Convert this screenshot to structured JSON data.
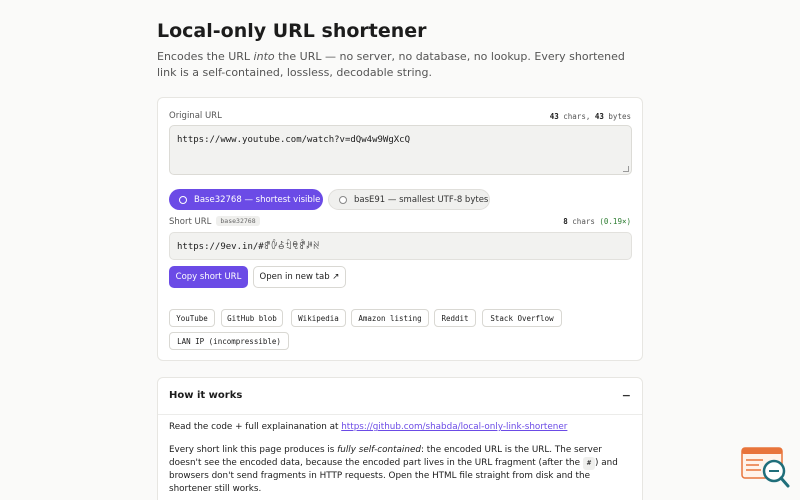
{
  "header": {
    "title": "Local-only URL shortener",
    "lede_pre": "Encodes the URL ",
    "lede_em": "into",
    "lede_post": " the URL — no server, no database, no lookup. Every shortened link is a self-contained, lossless, decodable string."
  },
  "original": {
    "label": "Original URL",
    "chars": "43",
    "chars_unit": " chars, ",
    "bytes": "43",
    "bytes_unit": " bytes",
    "value": "https://www.youtube.com/watch?v=dQw4w9WgXcQ"
  },
  "encodings": [
    {
      "label": "Base32768 — shortest visible",
      "selected": true
    },
    {
      "label": "basE91 — smallest UTF-8 bytes",
      "selected": false
    }
  ],
  "short": {
    "label": "Short URL",
    "tag": "base32768",
    "chars": "8",
    "chars_unit": " chars ",
    "ratio": "(0.19×)",
    "value": "https://9ev.in/#ꍗꊳꊵꉫꋠꍖꎎꋊ"
  },
  "actions": {
    "copy": "Copy short URL",
    "open": "Open in new tab ↗"
  },
  "examples": [
    "YouTube",
    "GitHub blob",
    "Wikipedia",
    "Amazon listing",
    "Reddit",
    "Stack Overflow",
    "LAN IP (incompressible)"
  ],
  "how": {
    "title": "How it works",
    "toggle": "−",
    "read_pre": "Read the code + full explainanation at ",
    "link": "https://github.com/shabda/local-only-link-shortener",
    "p2_a": "Every short link this page produces is ",
    "p2_em": "fully self-contained",
    "p2_b": ": the encoded URL is the URL. The server doesn't see the encoded data, because the encoded part lives in the URL fragment (after the ",
    "p2_code": "#",
    "p2_c": ") and browsers don't send fragments in HTTP requests. Open the HTML file straight from disk and the shortener still works."
  },
  "colors": {
    "accent": "#6b4be6",
    "ratio_green": "#2e7d32",
    "widget_orange": "#e8743b",
    "widget_teal": "#1f6e7a"
  }
}
